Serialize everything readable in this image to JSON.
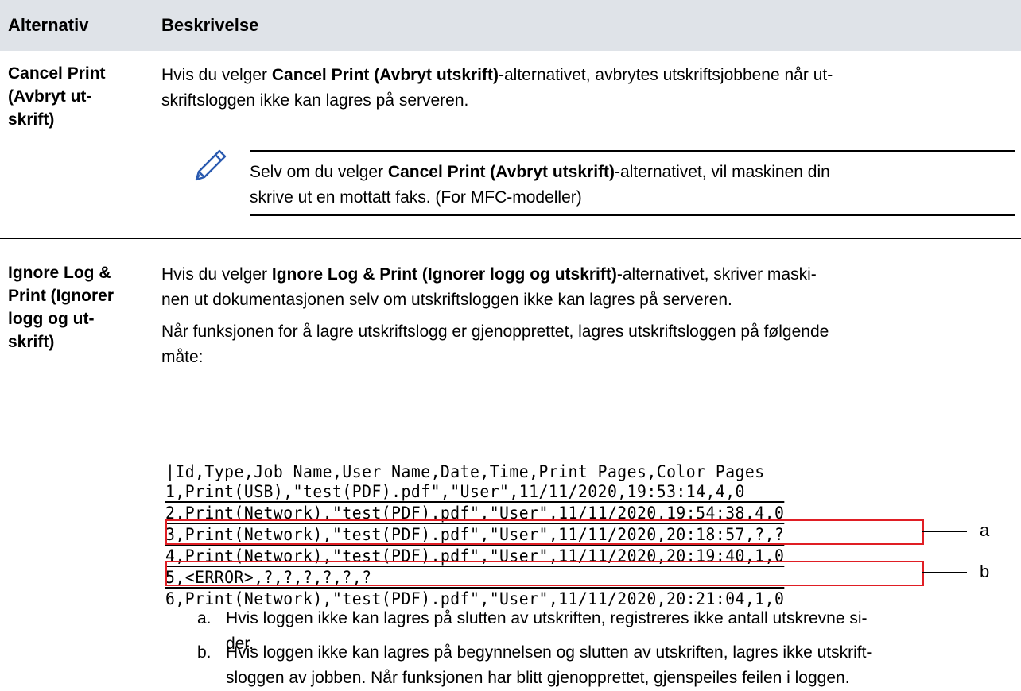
{
  "table": {
    "headers": [
      "Alternativ",
      "Beskrivelse"
    ],
    "rows": [
      {
        "option_lines": [
          "Cancel Print",
          "(Avbryt ut-",
          "skrift)"
        ],
        "desc_lines": [
          {
            "pre": "Hvis du velger ",
            "bold": "Cancel Print (Avbryt utskrift)",
            "post": "-alternativet, avbrytes utskriftsjobbene når ut-"
          },
          {
            "pre": "skriftsloggen ikke kan lagres på serveren.",
            "bold": "",
            "post": ""
          }
        ],
        "note": {
          "icon": "pencil-icon",
          "lines": [
            {
              "pre": "Selv om du velger ",
              "bold": "Cancel Print (Avbryt utskrift)",
              "post": "-alternativet, vil maskinen din"
            },
            {
              "pre": "skrive ut en mottatt faks. (For MFC-modeller)",
              "bold": "",
              "post": ""
            }
          ]
        }
      },
      {
        "option_lines": [
          "Ignore Log &",
          "Print (Ignorer",
          "logg og ut-",
          "skrift)"
        ],
        "desc_lines": [
          {
            "pre": "Hvis du velger ",
            "bold": "Ignore Log & Print (Ignorer logg og utskrift)",
            "post": "-alternativet, skriver maski-"
          },
          {
            "pre": "nen ut dokumentasjonen selv om utskriftsloggen ikke kan lagres på serveren.",
            "bold": "",
            "post": ""
          }
        ],
        "desc2_lines": [
          "Når funksjonen for å lagre utskriftslogg er gjenopprettet, lagres utskriftsloggen på følgende",
          "måte:"
        ],
        "log_lines": [
          "|Id,Type,Job Name,User Name,Date,Time,Print Pages,Color Pages",
          "1,Print(USB),\"test(PDF).pdf\",\"User\",11/11/2020,19:53:14,4,0",
          "2,Print(Network),\"test(PDF).pdf\",\"User\",11/11/2020,19:54:38,4,0",
          "3,Print(Network),\"test(PDF).pdf\",\"User\",11/11/2020,20:18:57,?,?",
          "4,Print(Network),\"test(PDF).pdf\",\"User\",11/11/2020,20:19:40,1,0",
          "5,<ERROR>,?,?,?,?,?,?",
          "6,Print(Network),\"test(PDF).pdf\",\"User\",11/11/2020,20:21:04,1,0"
        ],
        "callouts": [
          "a",
          "b"
        ],
        "items": [
          {
            "label": "a.",
            "lines": [
              "Hvis loggen ikke kan lagres på slutten av utskriften, registreres ikke antall utskrevne si-",
              "der."
            ]
          },
          {
            "label": "b.",
            "lines": [
              "Hvis loggen ikke kan lagres på begynnelsen og slutten av utskriften, lagres ikke utskrift-",
              "sloggen av jobben. Når funksjonen har blitt gjenopprettet, gjenspeiles feilen i loggen."
            ]
          }
        ]
      }
    ]
  },
  "colors": {
    "header_bg": "#dfe3e8",
    "highlight_box": "#e01e24"
  }
}
